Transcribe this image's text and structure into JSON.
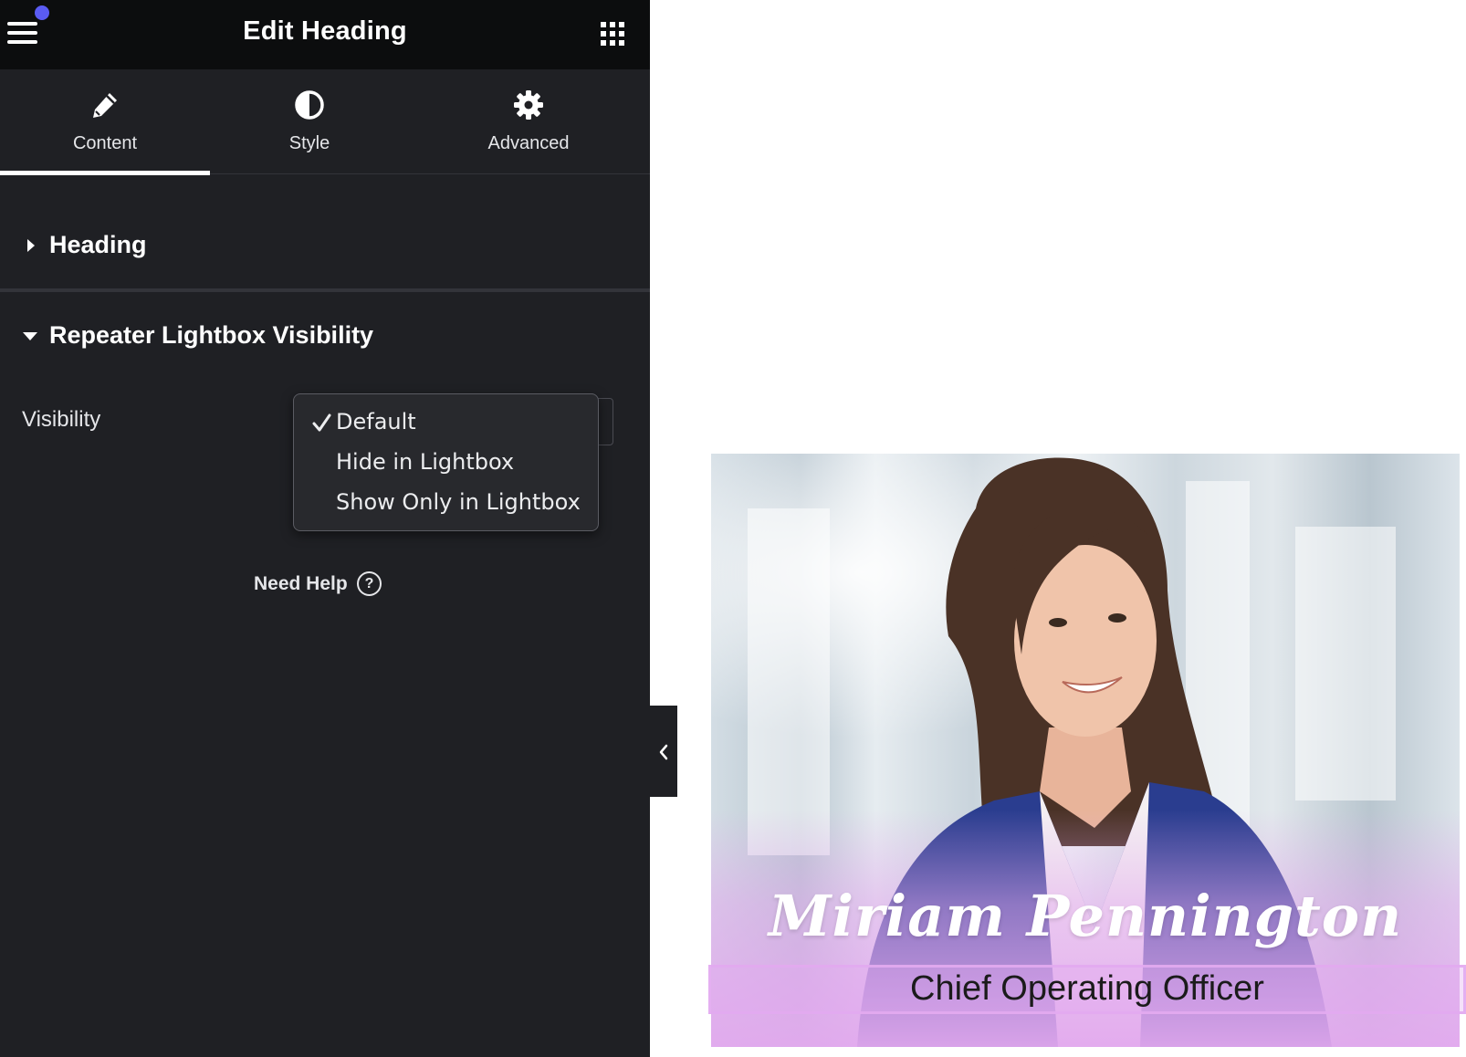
{
  "header": {
    "title": "Edit Heading",
    "menu_icon": "hamburger-icon",
    "apps_icon": "grid-icon",
    "notification_color": "#5a5bf3"
  },
  "tabs": [
    {
      "label": "Content",
      "icon": "pencil-icon",
      "active": true
    },
    {
      "label": "Style",
      "icon": "half-circle-icon",
      "active": false
    },
    {
      "label": "Advanced",
      "icon": "gear-icon",
      "active": false
    }
  ],
  "sections": {
    "heading": {
      "title": "Heading",
      "expanded": false
    },
    "repeater": {
      "title": "Repeater Lightbox Visibility",
      "expanded": true
    }
  },
  "visibility": {
    "label": "Visibility",
    "selected": "Default",
    "options": [
      "Default",
      "Hide in Lightbox",
      "Show Only in Lightbox"
    ]
  },
  "help": {
    "label": "Need Help",
    "icon": "question-circle-icon"
  },
  "preview": {
    "name": "Miriam Pennington",
    "role": "Chief Operating Officer",
    "overlay_color": "#e2a8ee"
  }
}
